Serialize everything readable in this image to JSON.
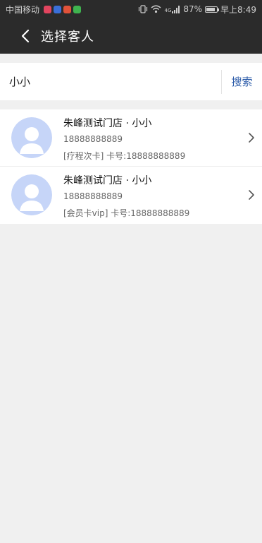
{
  "status_bar": {
    "carrier": "中国移动",
    "network": "4G",
    "battery": "87%",
    "battery_level": 0.87,
    "time": "早上8:49"
  },
  "header": {
    "title": "选择客人"
  },
  "search": {
    "value": "小小",
    "button_label": "搜索"
  },
  "customers": [
    {
      "name": "朱峰测试门店 · 小小",
      "phone": "18888888889",
      "card": "[疗程次卡] 卡号:18888888889"
    },
    {
      "name": "朱峰测试门店 · 小小",
      "phone": "18888888889",
      "card": "[会员卡vip] 卡号:18888888889"
    }
  ],
  "colors": {
    "header_bg": "#2b2b2b",
    "accent": "#2a5aa8",
    "avatar_bg": "#c6d5f8",
    "page_bg": "#f0f0f0"
  }
}
